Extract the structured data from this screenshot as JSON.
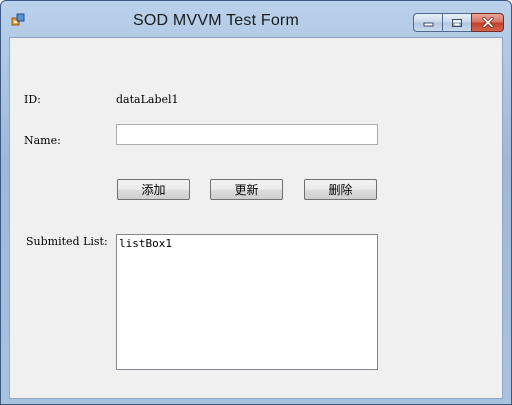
{
  "window": {
    "title": "SOD MVVM Test Form",
    "icon": "winforms-app-icon"
  },
  "form": {
    "id_label": "ID:",
    "id_value": "dataLabel1",
    "name_label": "Name:",
    "name_value": "",
    "buttons": {
      "add_label": "添加",
      "update_label": "更新",
      "delete_label": "删除"
    },
    "list_label": "Submited List:",
    "list_items": [
      "listBox1"
    ]
  }
}
